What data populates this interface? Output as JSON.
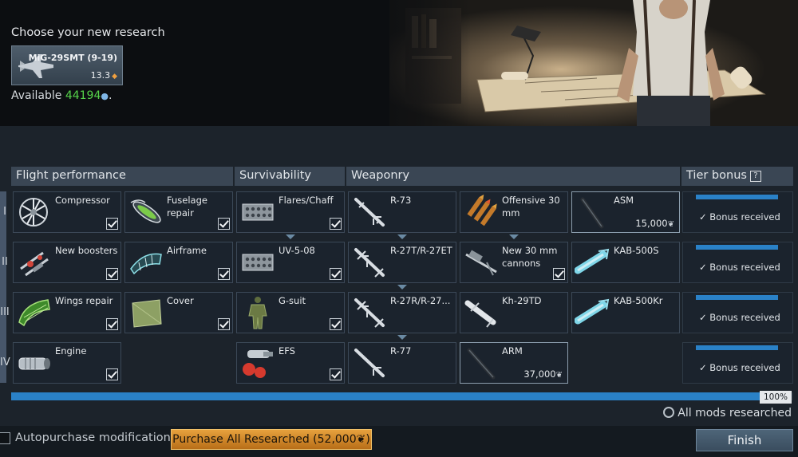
{
  "header": {
    "title": "Choose your new research",
    "vehicle": {
      "name": "MiG-29SMT (9-19)",
      "br": "13.3"
    },
    "available_label": "Available",
    "available_value": "44194"
  },
  "columns": {
    "flight": "Flight performance",
    "survivability": "Survivability",
    "weaponry": "Weaponry",
    "tier_bonus": "Tier bonus",
    "help": "?"
  },
  "tiers": [
    "I",
    "II",
    "III",
    "IV"
  ],
  "modules": {
    "compressor": {
      "name": "Compressor",
      "researched": true
    },
    "fuselage_repair": {
      "name": "Fuselage repair",
      "researched": true
    },
    "new_boosters": {
      "name": "New boosters",
      "researched": true
    },
    "airframe": {
      "name": "Airframe",
      "researched": true
    },
    "wings_repair": {
      "name": "Wings repair",
      "researched": true
    },
    "cover": {
      "name": "Cover",
      "researched": true
    },
    "engine": {
      "name": "Engine",
      "researched": true
    },
    "flares_chaff": {
      "name": "Flares/Chaff",
      "researched": true
    },
    "uv_5_08": {
      "name": "UV-5-08",
      "researched": true
    },
    "g_suit": {
      "name": "G-suit",
      "researched": true
    },
    "efs": {
      "name": "EFS",
      "researched": true
    },
    "r73": {
      "name": "R-73"
    },
    "r27t": {
      "name": "R-27T/R-27ET"
    },
    "r27r": {
      "name": "R-27R/R-27..."
    },
    "r77": {
      "name": "R-77"
    },
    "offensive_30mm": {
      "name": "Offensive 30 mm"
    },
    "new_30mm": {
      "name": "New 30 mm cannons",
      "researched": true
    },
    "kh29td": {
      "name": "Kh-29TD"
    },
    "arm": {
      "name": "ARM",
      "cost": "37,000"
    },
    "asm": {
      "name": "ASM",
      "cost": "15,000"
    },
    "kab500s": {
      "name": "KAB-500S"
    },
    "kab500kr": {
      "name": "KAB-500Kr"
    }
  },
  "bonus": {
    "label": "Bonus received"
  },
  "progress": {
    "percent": "100%",
    "fraction": 1.0
  },
  "status": {
    "all_mods": "All mods researched"
  },
  "footer": {
    "autopurchase": "Autopurchase modifications",
    "purchase_button": "Purchase All Researched (52,000",
    "finish_button": "Finish"
  },
  "colors": {
    "accent_blue": "#2a81c7",
    "purchase_gold": "#e7a13d",
    "rp_green": "#56d34a"
  }
}
